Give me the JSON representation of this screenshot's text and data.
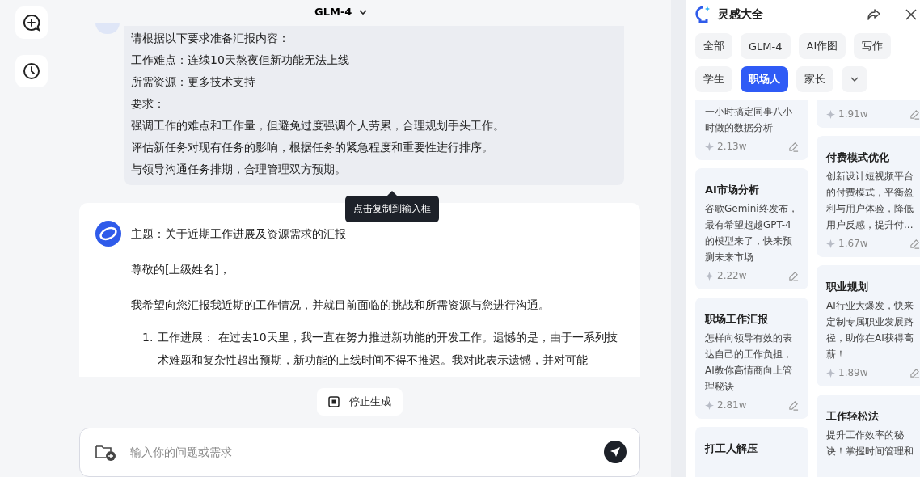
{
  "header": {
    "model": "GLM-4"
  },
  "user_message": {
    "lines": [
      "请根据以下要求准备汇报内容：",
      "工作难点：连续10天熬夜但新功能无法上线",
      "所需资源：更多技术支持",
      "要求：",
      "强调工作的难点和工作量，但避免过度强调个人劳累，合理规划手头工作。",
      "评估新任务对现有任务的影响，根据任务的紧急程度和重要性进行排序。",
      "与领导沟通任务排期，合理管理双方预期。"
    ]
  },
  "tooltip": "点击复制到输入框",
  "reply": {
    "paragraphs": [
      "主题：关于近期工作进展及资源需求的汇报",
      "尊敬的[上级姓名]，",
      "我希望向您汇报我近期的工作情况，并就目前面临的挑战和所需资源与您进行沟通。"
    ],
    "list": [
      {
        "marker": "1.",
        "text": "工作进展： 在过去10天里，我一直在努力推进新功能的开发工作。遗憾的是，由于一系列技术难题和复杂性超出预期，新功能的上线时间不得不推迟。我对此表示遗憾，并对可能"
      }
    ]
  },
  "stop_button": "停止生成",
  "input": {
    "placeholder": "输入你的问题或需求"
  },
  "panel": {
    "title": "灵感大全",
    "chips": [
      {
        "label": "全部",
        "selected": false
      },
      {
        "label": "GLM-4",
        "selected": false
      },
      {
        "label": "AI作图",
        "selected": false
      },
      {
        "label": "写作",
        "selected": false
      },
      {
        "label": "学生",
        "selected": false
      },
      {
        "label": "职场人",
        "selected": true
      },
      {
        "label": "家长",
        "selected": false
      }
    ],
    "columns": [
      [
        {
          "desc": "一小时搞定同事八小时做的数据分析",
          "count": "2.13w"
        },
        {
          "title": "AI市场分析",
          "desc": "谷歌Gemini终发布，最有希望超越GPT-4的模型来了，快来预测未来市场",
          "count": "2.22w"
        },
        {
          "title": "职场工作汇报",
          "desc": "怎样向领导有效的表达自己的工作负担，AI教你高情商向上管理秘诀",
          "count": "2.81w"
        },
        {
          "title": "打工人解压"
        }
      ],
      [
        {
          "count": "1.91w"
        },
        {
          "title": "付费模式优化",
          "desc": "创新设计短视频平台的付费模式，平衡盈利与用户体验，降低用户反感，提升付...",
          "count": "1.67w"
        },
        {
          "title": "职业规划",
          "desc": "AI行业大爆发，快来定制专属职业发展路径，助你在AI获得高薪！",
          "count": "1.89w"
        },
        {
          "title": "工作轻松法",
          "desc": "提升工作效率的秘诀！掌握时间管理和"
        }
      ]
    ]
  }
}
